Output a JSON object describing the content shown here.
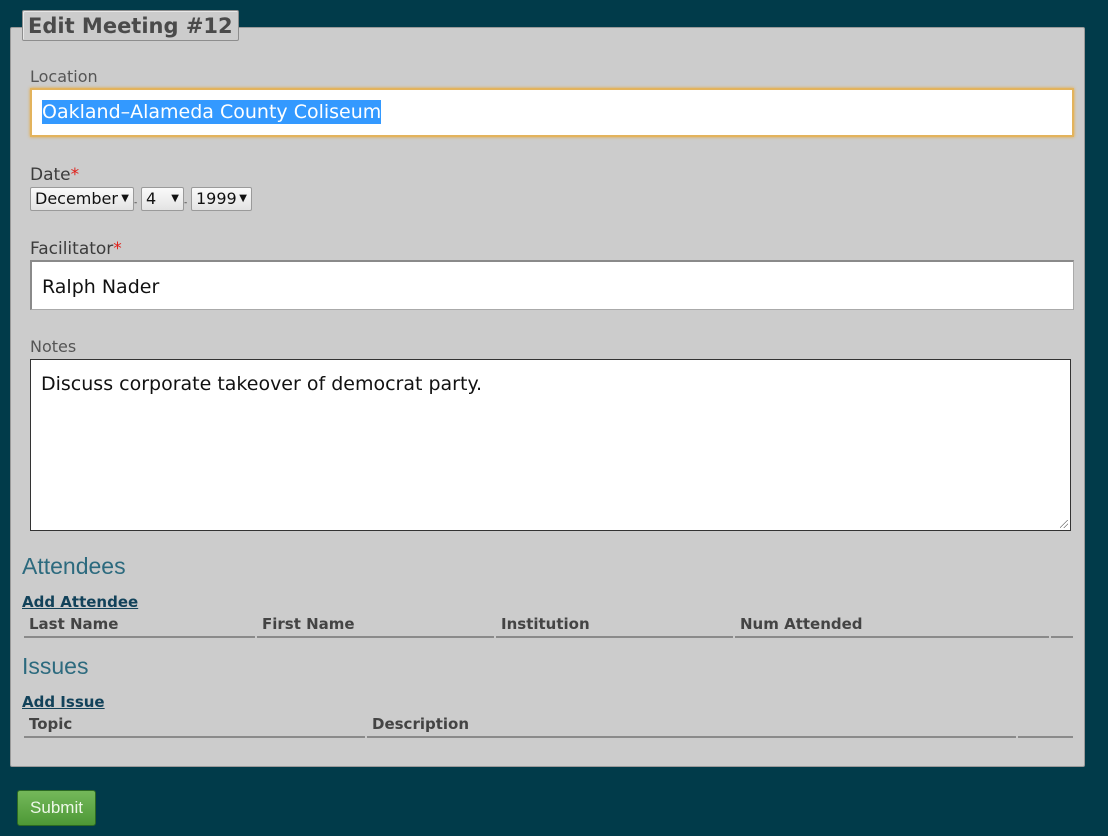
{
  "form": {
    "title": "Edit Meeting #12",
    "location": {
      "label": "Location",
      "value": "Oakland–Alameda County Coliseum"
    },
    "date": {
      "label": "Date",
      "required_mark": "*",
      "month": "December",
      "day": "4",
      "year": "1999",
      "separator": "-"
    },
    "facilitator": {
      "label": "Facilitator",
      "required_mark": "*",
      "value": "Ralph Nader"
    },
    "notes": {
      "label": "Notes",
      "value": "Discuss corporate takeover of democrat party."
    }
  },
  "attendees": {
    "title": "Attendees",
    "add_link": "Add Attendee",
    "columns": [
      "Last Name",
      "First Name",
      "Institution",
      "Num Attended",
      ""
    ]
  },
  "issues": {
    "title": "Issues",
    "add_link": "Add Issue",
    "columns": [
      "Topic",
      "Description",
      ""
    ]
  },
  "submit_label": "Submit",
  "colors": {
    "background": "#013b4a",
    "panel": "#cccccc",
    "section_heading": "#2c6a7e",
    "link": "#12425a",
    "required": "#e0201a",
    "submit": "#5ca744",
    "selection": "#3399ff",
    "focus_border": "#e3b35c"
  }
}
